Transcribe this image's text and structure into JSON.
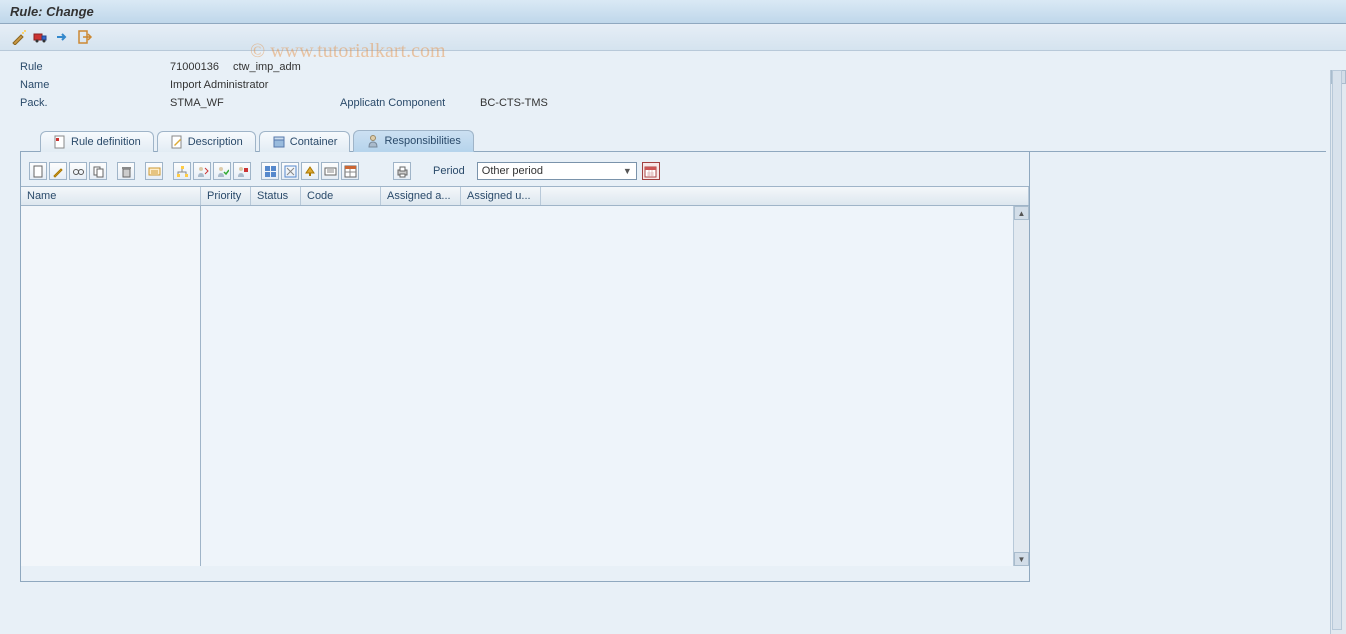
{
  "title": "Rule: Change",
  "watermark": "© www.tutorialkart.com",
  "fields": {
    "rule_label": "Rule",
    "rule_id": "71000136",
    "rule_tech": "ctw_imp_adm",
    "name_label": "Name",
    "name_value": "Import Administrator",
    "pack_label": "Pack.",
    "pack_value": "STMA_WF",
    "appcomp_label": "Applicatn Component",
    "appcomp_value": "BC-CTS-TMS"
  },
  "tabs": {
    "definition": "Rule definition",
    "description": "Description",
    "container": "Container",
    "responsibilities": "Responsibilities"
  },
  "period": {
    "label": "Period",
    "value": "Other period"
  },
  "grid": {
    "col_name": "Name",
    "col_priority": "Priority",
    "col_status": "Status",
    "col_code": "Code",
    "col_assigned_a": "Assigned a...",
    "col_assigned_u": "Assigned u..."
  }
}
